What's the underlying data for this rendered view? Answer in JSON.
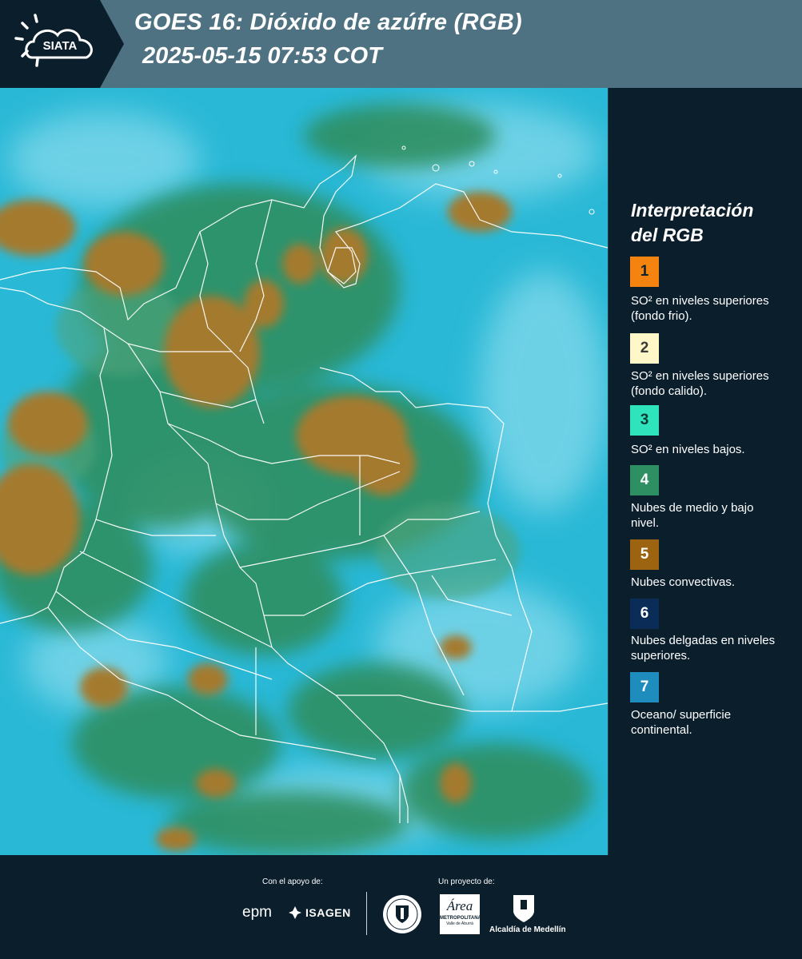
{
  "header": {
    "logo_text": "SIATA",
    "title_line1": "GOES 16: Dióxido de azúfre (RGB)",
    "title_line2": "2025-05-15 07:53 COT"
  },
  "legend": {
    "title_line1": "Interpretación",
    "title_line2": "del RGB",
    "items": [
      {
        "number": "1",
        "color": "#f4830f",
        "text_color": "#10222e",
        "label": "SO² en niveles superiores (fondo frio)."
      },
      {
        "number": "2",
        "color": "#fff7c8",
        "text_color": "#3a3a3a",
        "label": "SO² en niveles superiores (fondo calido)."
      },
      {
        "number": "3",
        "color": "#2fe3bd",
        "text_color": "#0e3a33",
        "label": "SO² en niveles bajos."
      },
      {
        "number": "4",
        "color": "#2e8f62",
        "text_color": "#ffffff",
        "label": "Nubes de medio y bajo nivel."
      },
      {
        "number": "5",
        "color": "#9c6410",
        "text_color": "#ffffff",
        "label": "Nubes convectivas."
      },
      {
        "number": "6",
        "color": "#0c2c58",
        "text_color": "#ffffff",
        "label": "Nubes delgadas en niveles superiores."
      },
      {
        "number": "7",
        "color": "#1e8dbd",
        "text_color": "#ffffff",
        "label": "Oceano/ superficie continental."
      }
    ]
  },
  "footer": {
    "support_caption": "Con el apoyo de:",
    "project_caption": "Un proyecto de:",
    "epm": "epm",
    "isagen": "ISAGEN",
    "area_word": "Área",
    "area_sub": "METROPOLITANA",
    "area_sub2": "Valle de Aburrá",
    "alcaldia": "Alcaldía de Medellín"
  }
}
